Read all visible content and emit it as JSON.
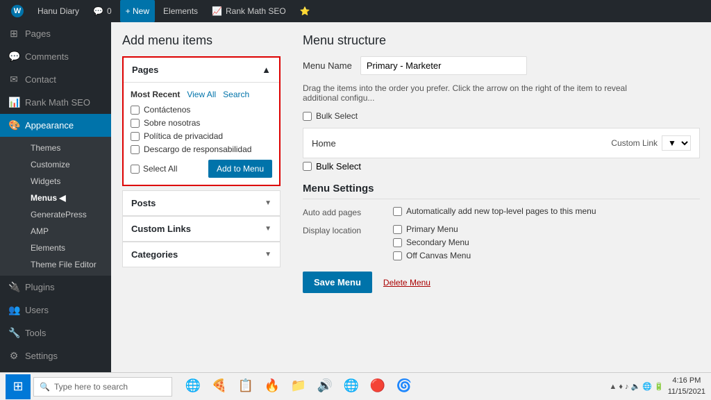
{
  "adminbar": {
    "site_name": "Hanu Diary",
    "logo": "W",
    "comment_count": "0",
    "new_label": "+ New",
    "elements_label": "Elements",
    "rankmath_label": "Rank Math SEO"
  },
  "sidebar": {
    "items": [
      {
        "icon": "⊞",
        "label": "Pages"
      },
      {
        "icon": "💬",
        "label": "Comments"
      },
      {
        "icon": "✉",
        "label": "Contact"
      },
      {
        "icon": "📊",
        "label": "Rank Math SEO"
      },
      {
        "icon": "🎨",
        "label": "Appearance",
        "active": true
      },
      {
        "icon": "",
        "label": "Themes"
      },
      {
        "icon": "",
        "label": "Customize"
      },
      {
        "icon": "",
        "label": "Widgets"
      },
      {
        "icon": "",
        "label": "Menus",
        "bold": true
      },
      {
        "icon": "",
        "label": "GeneratePress"
      },
      {
        "icon": "",
        "label": "AMP"
      },
      {
        "icon": "",
        "label": "Elements"
      },
      {
        "icon": "",
        "label": "Theme File Editor"
      },
      {
        "icon": "🔌",
        "label": "Plugins"
      },
      {
        "icon": "👥",
        "label": "Users"
      },
      {
        "icon": "🔧",
        "label": "Tools"
      },
      {
        "icon": "⚙",
        "label": "Settings"
      }
    ]
  },
  "add_menu": {
    "title": "Add menu items",
    "pages_section": {
      "title": "Pages",
      "tabs": [
        "Most Recent",
        "View All",
        "Search"
      ],
      "active_tab": "Most Recent",
      "items": [
        {
          "label": "Contáctenos"
        },
        {
          "label": "Sobre nosotras"
        },
        {
          "label": "Política de privacidad"
        },
        {
          "label": "Descargo de responsabilidad"
        }
      ],
      "select_all_label": "Select All",
      "add_button": "Add to Menu"
    },
    "posts_section": {
      "title": "Posts"
    },
    "custom_links_section": {
      "title": "Custom Links"
    },
    "categories_section": {
      "title": "Categories"
    }
  },
  "menu_structure": {
    "title": "Menu structure",
    "menu_name_label": "Menu Name",
    "menu_name_value": "Primary - Marketer",
    "drag_hint": "Drag the items into the order you prefer. Click the arrow on the right of the item to reveal additional configu...",
    "bulk_select_label": "Bulk Select",
    "menu_item": {
      "label": "Home",
      "type": "Custom Link"
    },
    "bulk_select_label2": "Bulk Select"
  },
  "menu_settings": {
    "title": "Menu Settings",
    "auto_add_label": "Auto add pages",
    "auto_add_option": "Automatically add new top-level pages to this menu",
    "display_location_label": "Display location",
    "locations": [
      {
        "label": "Primary Menu"
      },
      {
        "label": "Secondary Menu"
      },
      {
        "label": "Off Canvas Menu"
      }
    ],
    "save_button": "Save Menu",
    "delete_link": "Delete Menu"
  },
  "taskbar": {
    "search_placeholder": "Type here to search",
    "time": "▲ ♦ ♪ ■ 圓 ◉ ○"
  }
}
